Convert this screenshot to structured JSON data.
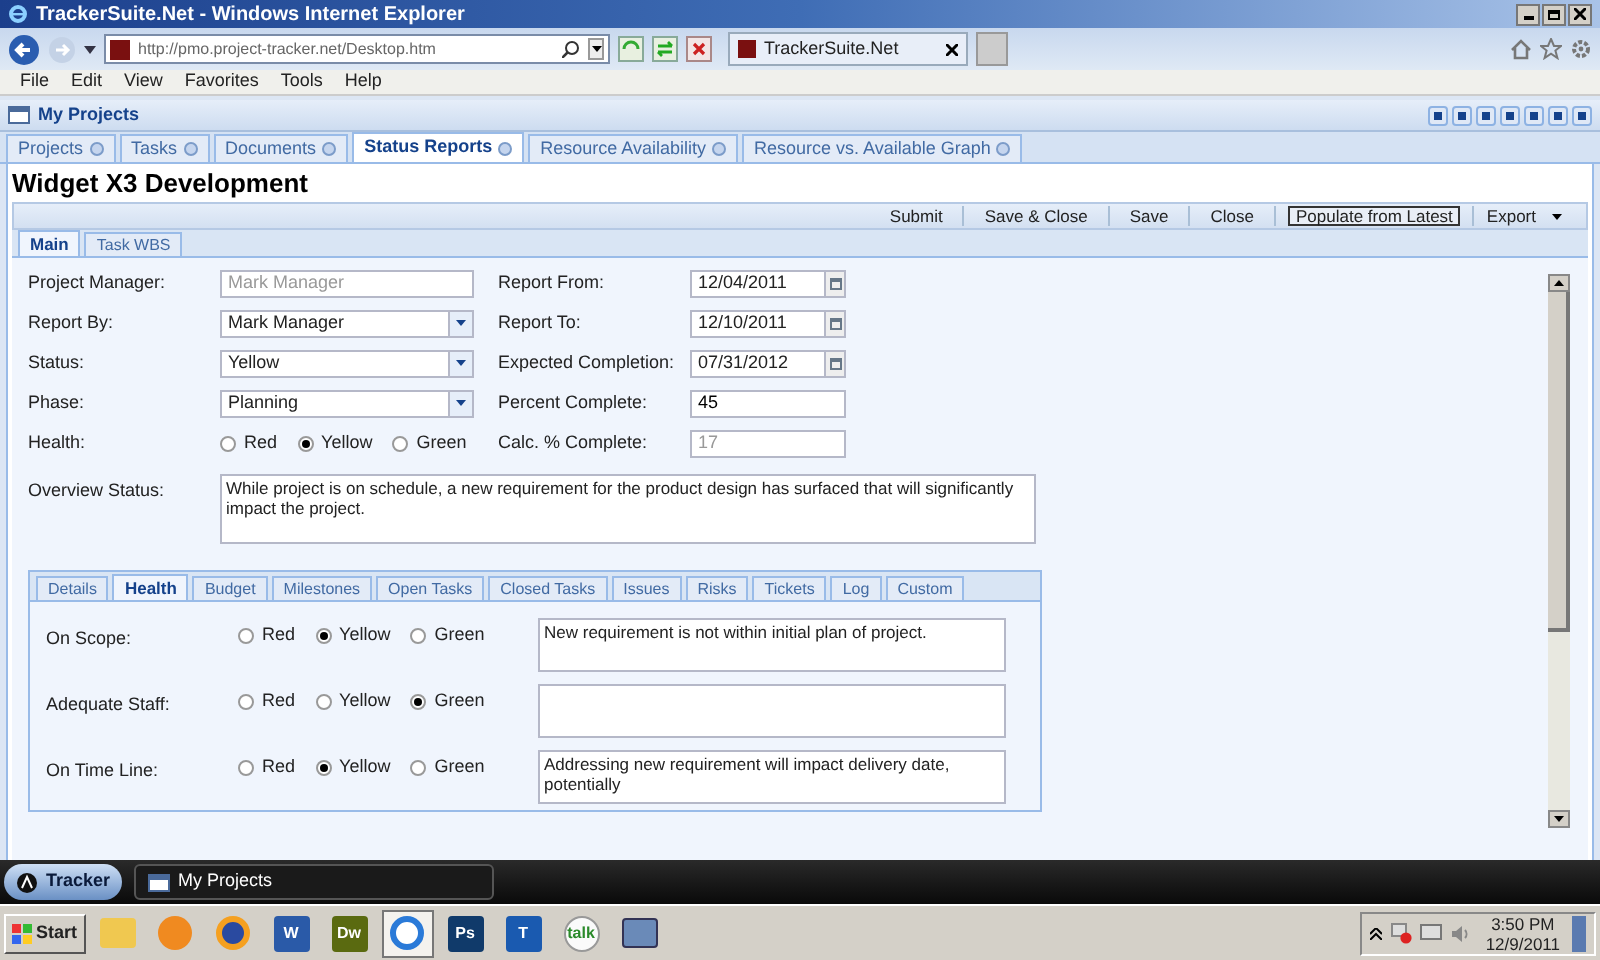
{
  "window": {
    "title": "TrackerSuite.Net - Windows Internet Explorer"
  },
  "browser": {
    "address": "http://pmo.project-tracker.net/Desktop.htm",
    "tab_title": "TrackerSuite.Net",
    "menu": [
      "File",
      "Edit",
      "View",
      "Favorites",
      "Tools",
      "Help"
    ]
  },
  "app": {
    "title": "My Projects"
  },
  "tabs": [
    {
      "label": "Projects",
      "selected": false
    },
    {
      "label": "Tasks",
      "selected": false
    },
    {
      "label": "Documents",
      "selected": false
    },
    {
      "label": "Status Reports",
      "selected": true
    },
    {
      "label": "Resource Availability",
      "selected": false
    },
    {
      "label": "Resource vs. Available Graph",
      "selected": false
    }
  ],
  "page": {
    "title": "Widget X3 Development"
  },
  "toolbar": [
    {
      "label": "Submit",
      "kind": "button"
    },
    {
      "label": "Save & Close",
      "kind": "button"
    },
    {
      "label": "Save",
      "kind": "button"
    },
    {
      "label": "Close",
      "kind": "button"
    },
    {
      "label": "Populate from Latest",
      "kind": "outlined"
    },
    {
      "label": "Export",
      "kind": "menu"
    }
  ],
  "form_tabs": [
    {
      "label": "Main",
      "selected": true
    },
    {
      "label": "Task WBS",
      "selected": false
    }
  ],
  "fields_left": [
    {
      "label": "Project Manager:",
      "kind": "text",
      "value": "Mark Manager",
      "disabled": true
    },
    {
      "label": "Report By:",
      "kind": "select",
      "value": "Mark Manager"
    },
    {
      "label": "Status:",
      "kind": "select",
      "value": "Yellow"
    },
    {
      "label": "Phase:",
      "kind": "select",
      "value": "Planning"
    },
    {
      "label": "Health:",
      "kind": "radio",
      "options": [
        {
          "label": "Red",
          "selected": false
        },
        {
          "label": "Yellow",
          "selected": true
        },
        {
          "label": "Green",
          "selected": false
        }
      ]
    }
  ],
  "fields_right": [
    {
      "label": "Report From:",
      "kind": "date",
      "value": "12/04/2011"
    },
    {
      "label": "Report To:",
      "kind": "date",
      "value": "12/10/2011"
    },
    {
      "label": "Expected Completion:",
      "kind": "date",
      "value": "07/31/2012"
    },
    {
      "label": "Percent Complete:",
      "kind": "text",
      "value": "45",
      "disabled": false
    },
    {
      "label": "Calc. % Complete:",
      "kind": "text",
      "value": "17",
      "disabled": true
    }
  ],
  "overview": {
    "label": "Overview Status:",
    "value": "While project is on schedule, a new requirement for the product design has surfaced that will significantly impact the project."
  },
  "detail_tabs": [
    {
      "label": "Details",
      "selected": false
    },
    {
      "label": "Health",
      "selected": true
    },
    {
      "label": "Budget",
      "selected": false
    },
    {
      "label": "Milestones",
      "selected": false
    },
    {
      "label": "Open Tasks",
      "selected": false
    },
    {
      "label": "Closed Tasks",
      "selected": false
    },
    {
      "label": "Issues",
      "selected": false
    },
    {
      "label": "Risks",
      "selected": false
    },
    {
      "label": "Tickets",
      "selected": false
    },
    {
      "label": "Log",
      "selected": false
    },
    {
      "label": "Custom",
      "selected": false
    }
  ],
  "health_rows": [
    {
      "label": "On Scope:",
      "options": [
        {
          "label": "Red",
          "selected": false
        },
        {
          "label": "Yellow",
          "selected": true
        },
        {
          "label": "Green",
          "selected": false
        }
      ],
      "comment": "New requirement is not within initial plan of project."
    },
    {
      "label": "Adequate Staff:",
      "options": [
        {
          "label": "Red",
          "selected": false
        },
        {
          "label": "Yellow",
          "selected": false
        },
        {
          "label": "Green",
          "selected": true
        }
      ]
    },
    {
      "label": "On Time Line:",
      "options": [
        {
          "label": "Red",
          "selected": false
        },
        {
          "label": "Yellow",
          "selected": true
        },
        {
          "label": "Green",
          "selected": false
        }
      ],
      "comment": "Addressing new requirement will impact delivery date, potentially"
    }
  ],
  "app_taskbar": [
    {
      "label": "Tracker",
      "selected": true
    },
    {
      "label": "My Projects",
      "selected": false
    }
  ],
  "taskbar": {
    "start": "Start",
    "apps": [
      {
        "kind": "folder",
        "selected": false
      },
      {
        "kind": "media",
        "selected": false
      },
      {
        "kind": "firefox",
        "selected": false
      },
      {
        "kind": "label",
        "label": "W",
        "selected": false
      },
      {
        "kind": "label",
        "label": "Dw",
        "selected": false
      },
      {
        "kind": "ie",
        "selected": true
      },
      {
        "kind": "label",
        "label": "Ps",
        "selected": false
      },
      {
        "kind": "label",
        "label": "T",
        "selected": false
      },
      {
        "kind": "label",
        "label": "talk",
        "selected": false
      },
      {
        "kind": "window",
        "selected": false
      }
    ],
    "time": "3:50 PM",
    "date": "12/9/2011"
  }
}
